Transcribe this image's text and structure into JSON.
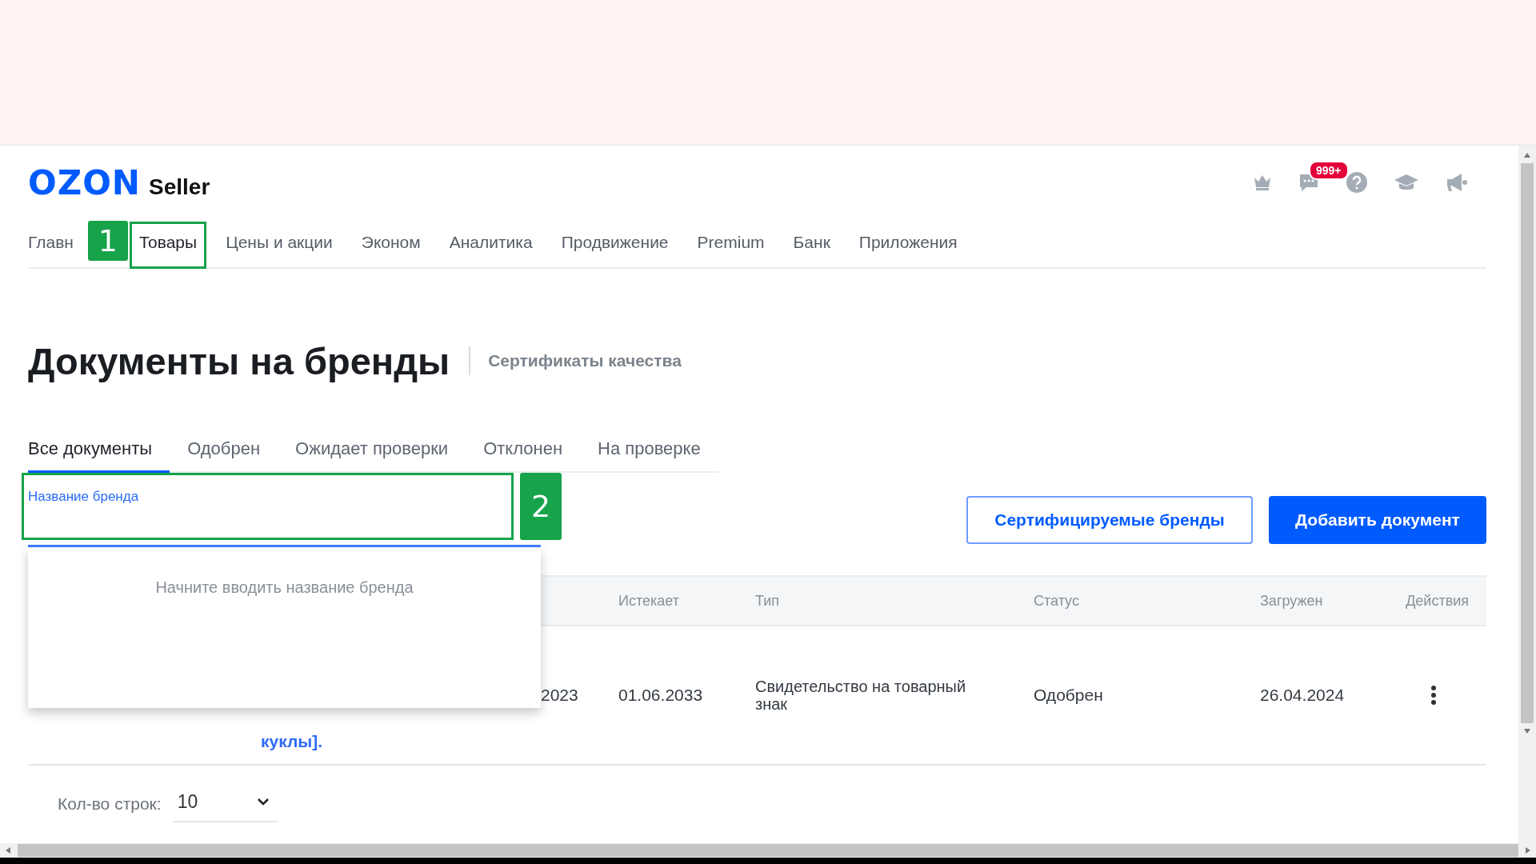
{
  "header": {
    "logo": "OZON",
    "logo_suffix": "Seller",
    "chat_badge": "999+"
  },
  "nav": [
    {
      "label": "Главн",
      "selected": false
    },
    {
      "label": "Товары",
      "selected": true,
      "annotation": "1"
    },
    {
      "label": "Цены и акции",
      "selected": false
    },
    {
      "label": "Эконом",
      "selected": false
    },
    {
      "label": "Аналитика",
      "selected": false
    },
    {
      "label": "Продвижение",
      "selected": false
    },
    {
      "label": "Premium",
      "selected": false
    },
    {
      "label": "Банк",
      "selected": false
    },
    {
      "label": "Приложения",
      "selected": false
    }
  ],
  "page": {
    "title": "Документы на бренды",
    "link": "Сертификаты качества"
  },
  "filter_tabs": [
    {
      "label": "Все документы",
      "selected": true
    },
    {
      "label": "Одобрен",
      "selected": false
    },
    {
      "label": "Ожидает проверки",
      "selected": false
    },
    {
      "label": "Отклонен",
      "selected": false
    },
    {
      "label": "На проверке",
      "selected": false
    }
  ],
  "brand_field": {
    "label": "Название бренда",
    "annotation": "2"
  },
  "dropdown": {
    "hint": "Начните вводить название бренда"
  },
  "buttons": [
    {
      "label": "Сертифицируемые бренды",
      "kind": "outline"
    },
    {
      "label": "Добавить документ",
      "kind": "primary"
    }
  ],
  "table": {
    "columns": [
      "Истекает",
      "Тип",
      "Статус",
      "Загружен",
      "Действия"
    ],
    "rows": [
      {
        "column_1": "куклы].",
        "column_2": "2023",
        "expires": "01.06.2033",
        "type": "Свидетельство на товарный знак",
        "status": "Одобрен",
        "uploaded": "26.04.2024"
      }
    ]
  },
  "footer": {
    "rows_label": "Кол-во строк:",
    "rows_value": "10"
  }
}
